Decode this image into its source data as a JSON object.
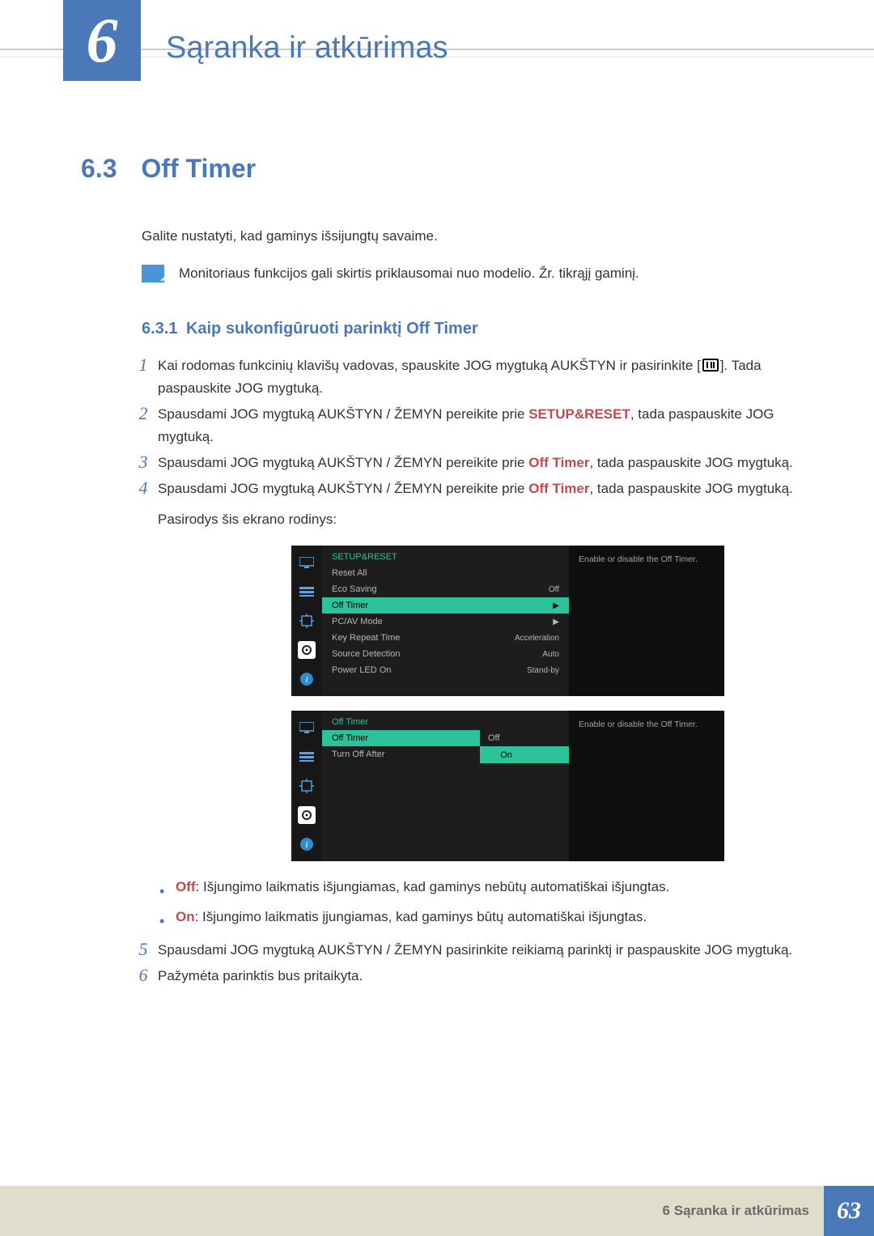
{
  "chapter": {
    "number": "6",
    "title": "Sąranka ir atkūrimas"
  },
  "section": {
    "number": "6.3",
    "title": "Off Timer"
  },
  "intro": "Galite nustatyti, kad gaminys išsijungtų savaime.",
  "note": "Monitoriaus funkcijos gali skirtis priklausomai nuo modelio. Žr. tikrąjį gaminį.",
  "subsection": {
    "number": "6.3.1",
    "title": "Kaip sukonfigūruoti parinktį Off Timer"
  },
  "steps": {
    "s1": {
      "num": "1",
      "t1": "Kai rodomas funkcinių klavišų vadovas, spauskite JOG mygtuką AUKŠTYN ir pasirinkite [",
      "t2": "]. Tada paspauskite JOG mygtuką."
    },
    "s2": {
      "num": "2",
      "t1": "Spausdami JOG mygtuką AUKŠTYN / ŽEMYN pereikite prie ",
      "emA": "SETUP&RESET",
      "t2": ", tada paspauskite JOG mygtuką."
    },
    "s3": {
      "num": "3",
      "t1": "Spausdami JOG mygtuką AUKŠTYN / ŽEMYN pereikite prie ",
      "emA": "Off Timer",
      "t2": ", tada paspauskite JOG mygtuką."
    },
    "s4": {
      "num": "4",
      "t1": "Spausdami JOG mygtuką AUKŠTYN / ŽEMYN pereikite prie ",
      "emA": "Off Timer",
      "t2": ", tada paspauskite JOG mygtuką.",
      "t3": "Pasirodys šis ekrano rodinys:"
    },
    "s5": {
      "num": "5",
      "t1": "Spausdami JOG mygtuką AUKŠTYN / ŽEMYN pasirinkite reikiamą parinktį ir paspauskite JOG mygtuką."
    },
    "s6": {
      "num": "6",
      "t1": "Pažymėta parinktis bus pritaikyta."
    }
  },
  "bullets": {
    "off_term": "Off",
    "off_text": ": Išjungimo laikmatis išjungiamas, kad gaminys nebūtų automatiškai išjungtas.",
    "on_term": "On",
    "on_text": ": Išjungimo laikmatis įjungiamas, kad gaminys būtų automatiškai išjungtas."
  },
  "osd1": {
    "head": "SETUP&RESET",
    "rows": [
      {
        "label": "Reset All",
        "value": ""
      },
      {
        "label": "Eco Saving",
        "value": "Off"
      },
      {
        "label": "Off Timer",
        "value": "▶",
        "hl": true
      },
      {
        "label": "PC/AV Mode",
        "value": "▶"
      },
      {
        "label": "Key Repeat Time",
        "value": "Acceleration"
      },
      {
        "label": "Source Detection",
        "value": "Auto"
      },
      {
        "label": "Power LED On",
        "value": "Stand-by"
      }
    ],
    "side": "Enable or disable the Off Timer."
  },
  "osd2": {
    "head": "Off Timer",
    "rows": [
      {
        "label": "Off Timer",
        "hl": true
      },
      {
        "label": "Turn Off After"
      }
    ],
    "options": [
      {
        "label": "Off"
      },
      {
        "label": "On",
        "hl": true,
        "check": true
      }
    ],
    "side": "Enable or disable the Off Timer."
  },
  "footer": {
    "label": "6 Sąranka ir atkūrimas",
    "page": "63"
  }
}
